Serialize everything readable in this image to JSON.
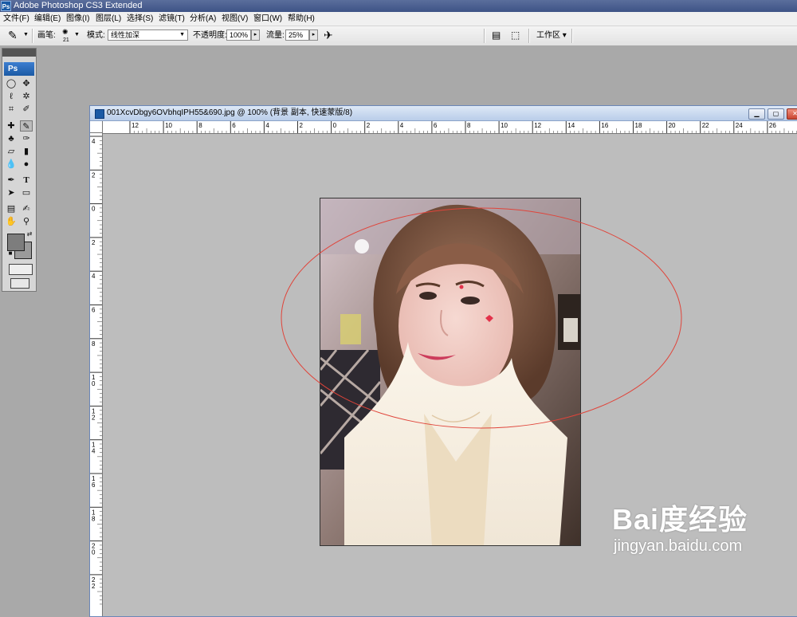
{
  "app": {
    "title": "Adobe Photoshop CS3 Extended",
    "badge": "Ps"
  },
  "menu": [
    "文件(F)",
    "编辑(E)",
    "图像(I)",
    "图层(L)",
    "选择(S)",
    "滤镜(T)",
    "分析(A)",
    "视图(V)",
    "窗口(W)",
    "帮助(H)"
  ],
  "options": {
    "brush_label": "画笔:",
    "brush_size": "21",
    "mode_label": "模式:",
    "mode_value": "线性加深",
    "opacity_label": "不透明度:",
    "opacity_value": "100%",
    "flow_label": "流量:",
    "flow_value": "25%",
    "workspace_label": "工作区 ▾"
  },
  "toolbox": {
    "logo": "Ps"
  },
  "document": {
    "title": "001XcvDbgy6OVbhqIPH55&690.jpg @ 100% (背景 副本, 快速蒙版/8)",
    "h_ticks": [
      "12",
      "10",
      "8",
      "6",
      "4",
      "2",
      "0",
      "2",
      "4",
      "6",
      "8",
      "10",
      "12",
      "14",
      "16",
      "18",
      "20",
      "22",
      "24",
      "26"
    ],
    "v_ticks": [
      "4",
      "2",
      "0",
      "2",
      "4",
      "6",
      "8",
      "10",
      "12",
      "14",
      "16",
      "18",
      "20",
      "22"
    ]
  },
  "watermark": {
    "logo": "Bai度经验",
    "url": "jingyan.baidu.com"
  },
  "colors": {
    "ellipse_stroke": "#e0443a",
    "title_bar": "#3e5386",
    "doc_title": "#c9d8ee"
  }
}
